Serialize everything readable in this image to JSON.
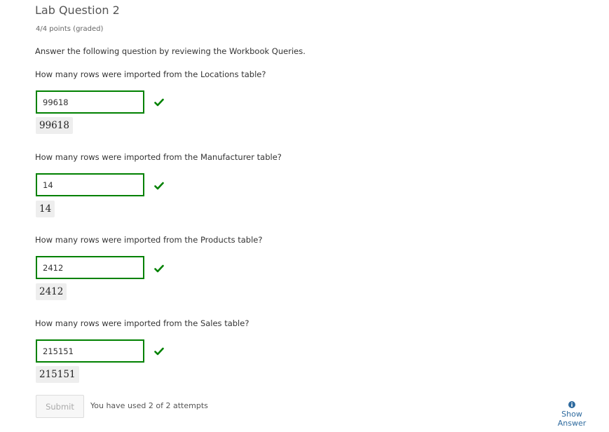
{
  "header": {
    "title": "Lab Question 2",
    "points": "4/4 points (graded)"
  },
  "instructions": "Answer the following question by reviewing the Workbook Queries.",
  "questions": [
    {
      "label": "How many rows were imported from the Locations table?",
      "value": "99618",
      "echo": "99618",
      "status": "correct"
    },
    {
      "label": "How many rows were imported from the Manufacturer table?",
      "value": "14",
      "echo": "14",
      "status": "correct"
    },
    {
      "label": "How many rows were imported from the Products table?",
      "value": "2412",
      "echo": "2412",
      "status": "correct"
    },
    {
      "label": "How many rows were imported from the Sales table?",
      "value": "215151",
      "echo": "215151",
      "status": "correct"
    }
  ],
  "footer": {
    "submit_label": "Submit",
    "attempts_text": "You have used 2 of 2 attempts",
    "show_answer_label": "Show Answer"
  },
  "colors": {
    "correct": "#008100",
    "link": "#2e6a9e"
  },
  "icons": {
    "check": "checkmark-icon",
    "info": "info-icon"
  }
}
